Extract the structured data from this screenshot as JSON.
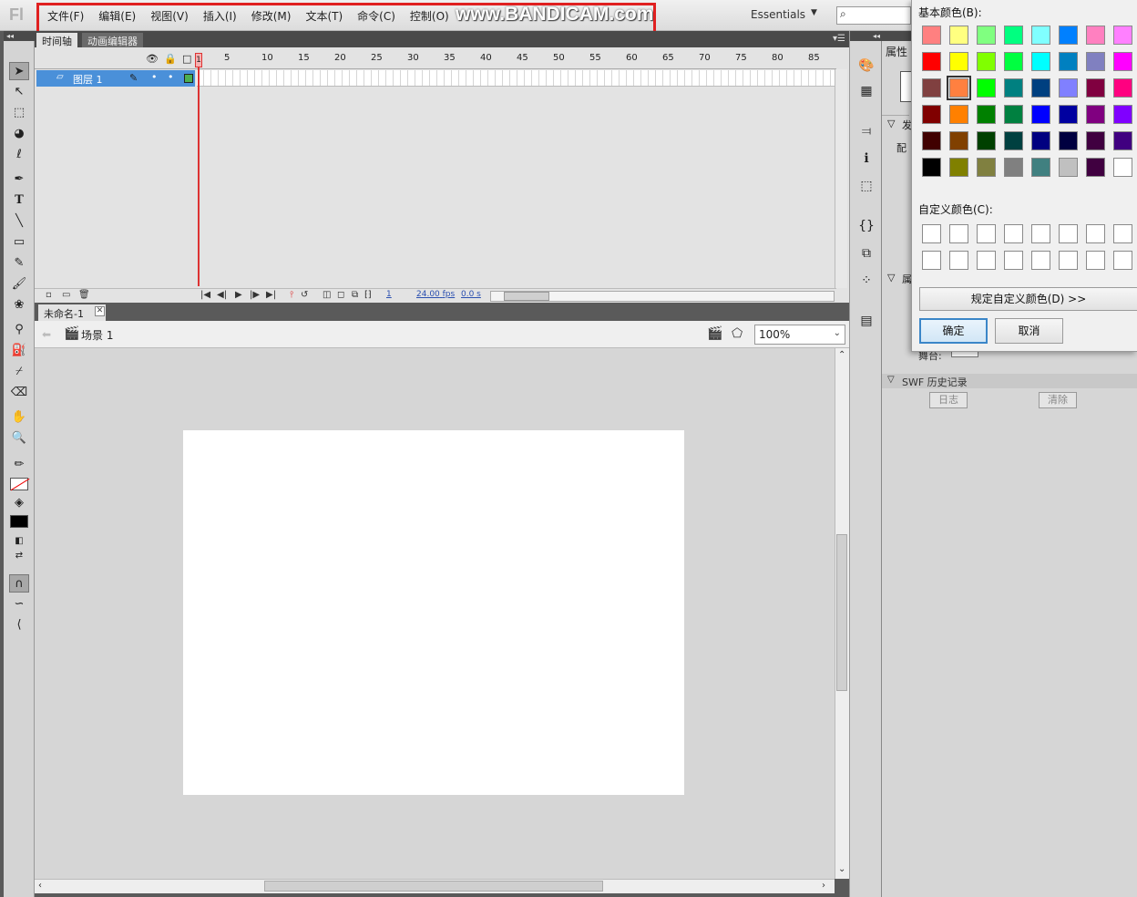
{
  "app": {
    "logo": "Fl",
    "workspace": "Essentials",
    "search_icon": "⌕"
  },
  "menu": {
    "items": [
      "文件(F)",
      "编辑(E)",
      "视图(V)",
      "插入(I)",
      "修改(M)",
      "文本(T)",
      "命令(C)",
      "控制(O)"
    ]
  },
  "watermark": "www.BANDICAM.com",
  "timeline": {
    "tabs": [
      "时间轴",
      "动画编辑器"
    ],
    "ruler_numbers": [
      "1",
      "5",
      "10",
      "15",
      "20",
      "25",
      "30",
      "35",
      "40",
      "45",
      "50",
      "55",
      "60",
      "65",
      "70",
      "75",
      "80",
      "85"
    ],
    "layer_name": "图层 1",
    "current_frame": "1",
    "frame_display": "1",
    "fps": "24.00",
    "fps_unit": "fps",
    "time": "0.0 s",
    "playhead_label": "1"
  },
  "document": {
    "tab_title": "未命名-1",
    "scene": "场景 1",
    "zoom": "100%"
  },
  "properties": {
    "tab": "属性",
    "swf_history": "SWF 历史记录",
    "log_button": "日志",
    "clear_button": "清除",
    "stage_label": "舞台:",
    "partial_label_1": "发",
    "partial_label_2": "配",
    "partial_label_3": "属"
  },
  "color_dialog": {
    "basic_colors_label": "基本颜色(B):",
    "custom_colors_label": "自定义颜色(C):",
    "define_button": "规定自定义颜色(D) >>",
    "ok_button": "确定",
    "cancel_button": "取消",
    "selected_color": "#ff8040",
    "basic_colors": [
      [
        "#ff8080",
        "#ffff80",
        "#80ff80",
        "#00ff80",
        "#80ffff",
        "#0080ff",
        "#ff80c0",
        "#ff80ff"
      ],
      [
        "#ff0000",
        "#ffff00",
        "#80ff00",
        "#00ff40",
        "#00ffff",
        "#0080c0",
        "#8080c0",
        "#ff00ff"
      ],
      [
        "#804040",
        "#ff8040",
        "#00ff00",
        "#008080",
        "#004080",
        "#8080ff",
        "#800040",
        "#ff0080"
      ],
      [
        "#800000",
        "#ff8000",
        "#008000",
        "#008040",
        "#0000ff",
        "#0000a0",
        "#800080",
        "#8000ff"
      ],
      [
        "#400000",
        "#804000",
        "#004000",
        "#004040",
        "#000080",
        "#000040",
        "#400040",
        "#400080"
      ],
      [
        "#000000",
        "#808000",
        "#808040",
        "#808080",
        "#408080",
        "#c0c0c0",
        "#400040",
        "#ffffff"
      ]
    ]
  }
}
